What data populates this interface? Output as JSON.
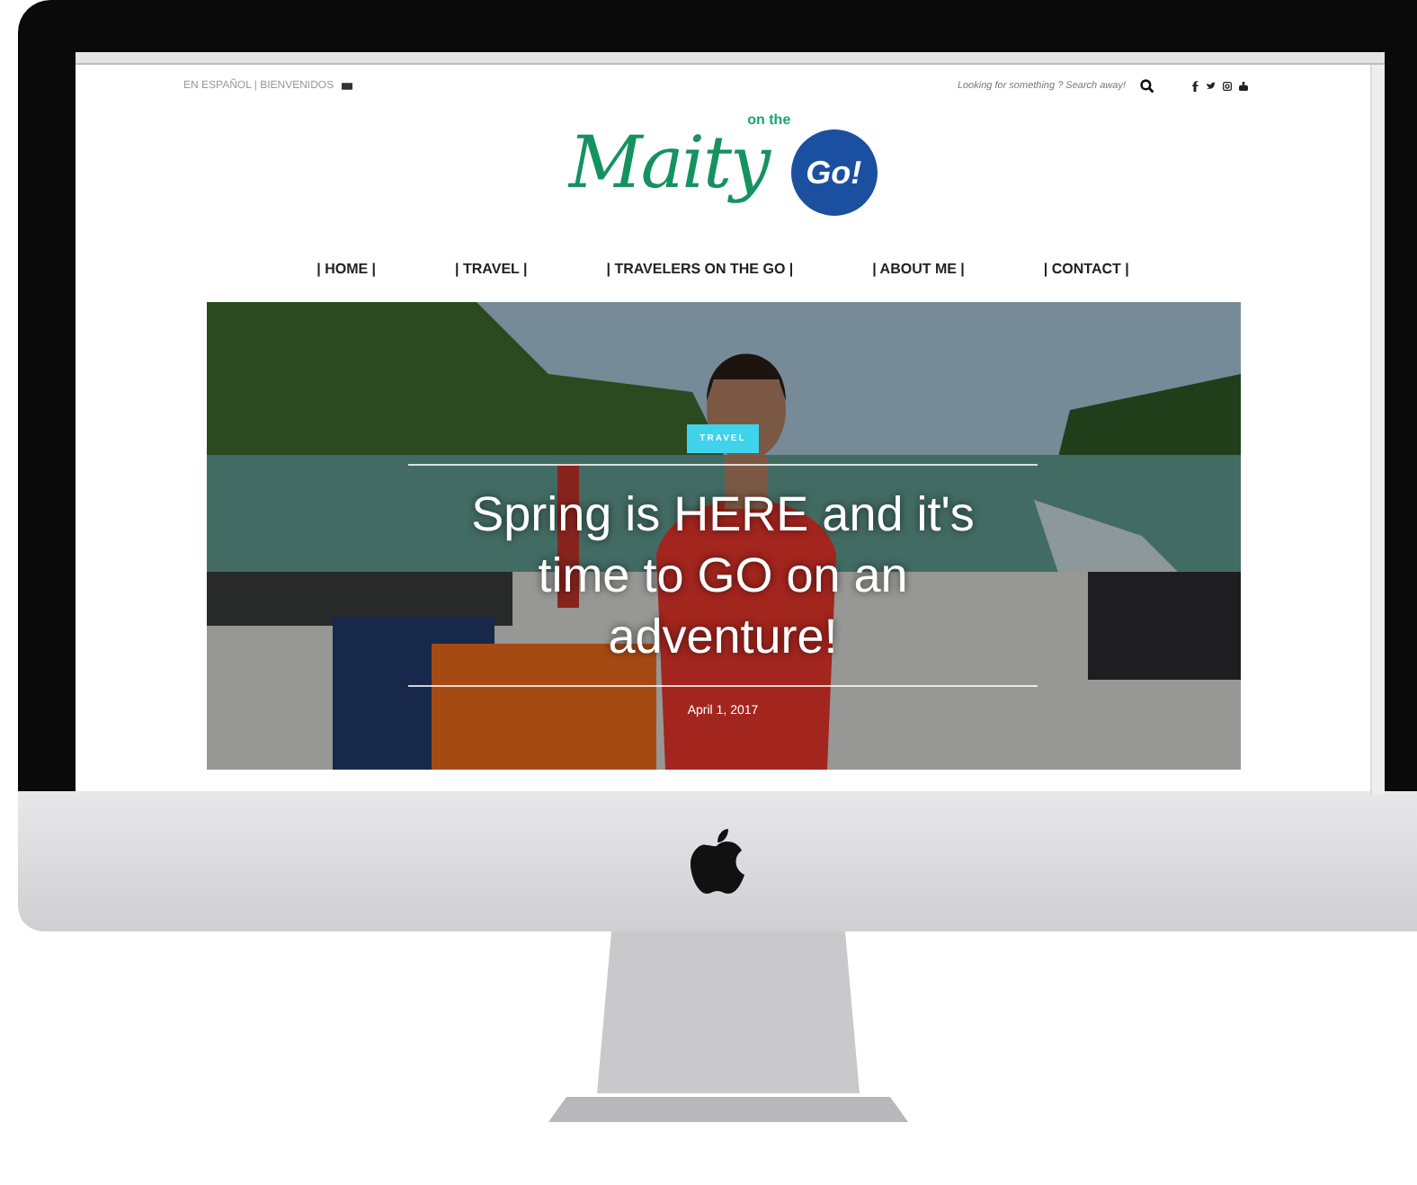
{
  "top_bar": {
    "language_links": "EN ESPAÑOL | BIENVENIDOS",
    "search": {
      "placeholder": "Looking for something ? Search away!"
    }
  },
  "logo": {
    "script": "Maity",
    "small": "on the",
    "badge": "Go!"
  },
  "nav": [
    {
      "label": "| HOME |"
    },
    {
      "label": "| TRAVEL |"
    },
    {
      "label": "| TRAVELERS ON THE GO |"
    },
    {
      "label": "| ABOUT ME |"
    },
    {
      "label": "| CONTACT |"
    }
  ],
  "hero": {
    "category": "TRAVEL",
    "title": "Spring is HERE and it's time to GO on an adventure!",
    "date": "April 1, 2017"
  }
}
